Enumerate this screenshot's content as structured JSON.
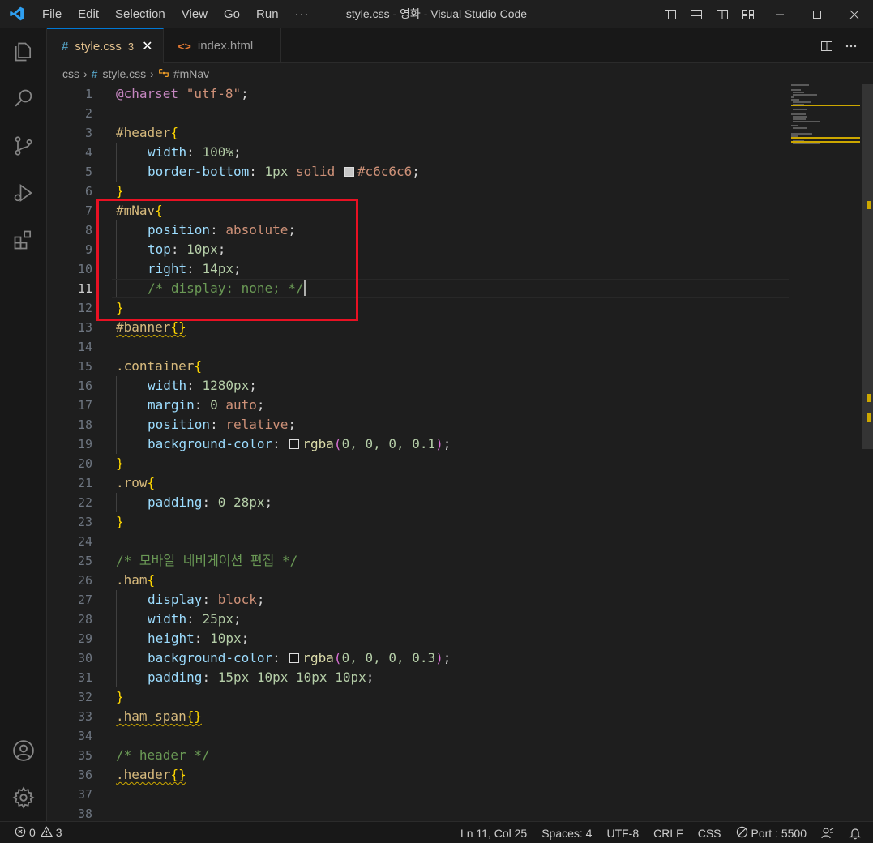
{
  "window": {
    "title": "style.css - 영화 - Visual Studio Code"
  },
  "menu": {
    "items": [
      "File",
      "Edit",
      "Selection",
      "View",
      "Go",
      "Run",
      "···"
    ]
  },
  "tabs": [
    {
      "icon": "#",
      "label": "style.css",
      "problems": "3",
      "active": true
    },
    {
      "icon": "<>",
      "label": "index.html",
      "active": false
    }
  ],
  "breadcrumbs": {
    "folder": "css",
    "file_icon": "#",
    "file": "style.css",
    "symbol": "#mNav"
  },
  "editor": {
    "current_line": 11,
    "line_numbers": [
      "1",
      "2",
      "3",
      "4",
      "5",
      "6",
      "7",
      "8",
      "9",
      "10",
      "11",
      "12",
      "13",
      "14",
      "15",
      "16",
      "17",
      "18",
      "19",
      "20",
      "21",
      "22",
      "23",
      "24",
      "25",
      "26",
      "27",
      "28",
      "29",
      "30",
      "31",
      "32",
      "33",
      "34",
      "35",
      "36",
      "37",
      "38"
    ],
    "lines": {
      "l1_at": "@charset",
      "l1_str": "\"utf-8\"",
      "l3_sel": "#header",
      "l4_prop": "width",
      "l4_num": "100%",
      "l5_prop": "border-bottom",
      "l5_num": "1px",
      "l5_kw": "solid",
      "l5_color": "#c6c6c6",
      "l7_sel": "#mNav",
      "l8_prop": "position",
      "l8_kw": "absolute",
      "l9_prop": "top",
      "l9_num": "10px",
      "l10_prop": "right",
      "l10_num": "14px",
      "l11_com": "/* display: none; */",
      "l13_sel": "#banner",
      "l15_sel": ".container",
      "l16_prop": "width",
      "l16_num": "1280px",
      "l17_prop": "margin",
      "l17_num": "0",
      "l17_kw": "auto",
      "l18_prop": "position",
      "l18_kw": "relative",
      "l19_prop": "background-color",
      "l19_fn": "rgba",
      "l19_args": "0, 0, 0, 0.1",
      "l21_sel": ".row",
      "l22_prop": "padding",
      "l22_num": "0 28px",
      "l25_com": "/* 모바일 네비게이션 편집 */",
      "l26_sel": ".ham",
      "l27_prop": "display",
      "l27_kw": "block",
      "l28_prop": "width",
      "l28_num": "25px",
      "l29_prop": "height",
      "l29_num": "10px",
      "l30_prop": "background-color",
      "l30_fn": "rgba",
      "l30_args": "0, 0, 0, 0.3",
      "l31_prop": "padding",
      "l31_num": "15px 10px 10px 10px",
      "l33_sel": ".ham span",
      "l35_com": "/* header */",
      "l36_sel": ".header"
    }
  },
  "statusbar": {
    "errors": "0",
    "warnings": "3",
    "position": "Ln 11, Col 25",
    "spaces": "Spaces: 4",
    "encoding": "UTF-8",
    "eol": "CRLF",
    "language": "CSS",
    "port": "Port : 5500"
  },
  "colors": {
    "accent": "#0078d4",
    "highlight_box": "#e81123",
    "warning": "#cca700"
  }
}
